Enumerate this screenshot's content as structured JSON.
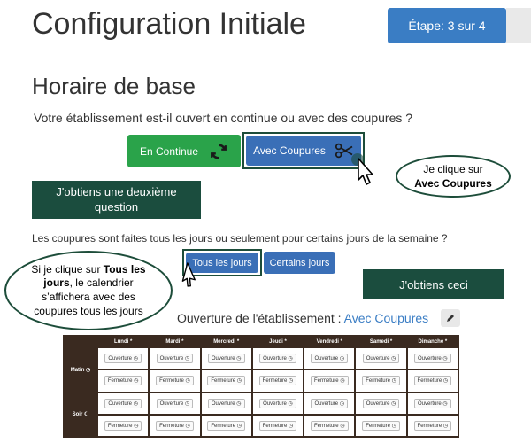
{
  "header": {
    "title": "Configuration Initiale",
    "step_badge": "Étape: 3 sur 4"
  },
  "section": {
    "title": "Horaire de base",
    "question1": "Votre établissement est-il ouvert en continue ou avec des coupures ?",
    "continue_button": "En Continue",
    "coupures_button": "Avec Coupures",
    "question2": "Les coupures sont faites tous les jours ou seulement pour certains jours de la semaine ?",
    "tous_button": "Tous les jours",
    "certains_button": "Certains jours"
  },
  "annotations": {
    "callout1_line1": "Je clique sur",
    "callout1_line2": "Avec Coupures",
    "note1": "J'obtiens une deuxième question",
    "callout2_prefix": "Si je clique sur ",
    "callout2_bold": "Tous les jours",
    "callout2_suffix": ", le calendrier s’affichera avec des coupures tous les jours",
    "note2": "J'obtiens ceci"
  },
  "calendar": {
    "title_prefix": "Ouverture de l'établissement : ",
    "title_value": "Avec Coupures",
    "days": [
      "Lundi",
      "Mardi",
      "Mercredi",
      "Jeudi",
      "Vendredi",
      "Samedi",
      "Dimanche"
    ],
    "required_mark": "*",
    "rows": [
      {
        "label": "Matin",
        "icon": "clock-icon",
        "slots": [
          "Ouverture",
          "Fermeture"
        ]
      },
      {
        "label": "Soir",
        "icon": "moon-icon",
        "slots": [
          "Ouverture",
          "Fermeture"
        ]
      }
    ]
  },
  "colors": {
    "accent_blue": "#3a7dc4",
    "button_green": "#2aa34a",
    "annotation_green": "#1b4d3e",
    "calendar_brown": "#3a2a20"
  }
}
